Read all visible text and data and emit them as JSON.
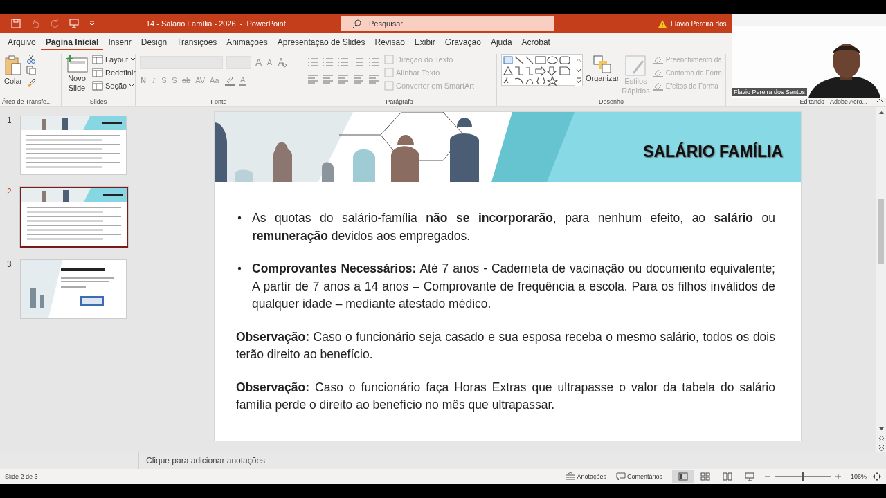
{
  "title_bar": {
    "title": "14 - Salário Família - 2026  -  PowerPoint",
    "search": {
      "placeholder": "Pesquisar"
    },
    "user": "Flavio Pereira dos"
  },
  "tabs": [
    {
      "label": "Arquivo",
      "selected": false
    },
    {
      "label": "Página Inicial",
      "selected": true
    },
    {
      "label": "Inserir",
      "selected": false
    },
    {
      "label": "Design",
      "selected": false
    },
    {
      "label": "Transições",
      "selected": false
    },
    {
      "label": "Animações",
      "selected": false
    },
    {
      "label": "Apresentação de Slides",
      "selected": false
    },
    {
      "label": "Revisão",
      "selected": false
    },
    {
      "label": "Exibir",
      "selected": false
    },
    {
      "label": "Gravação",
      "selected": false
    },
    {
      "label": "Ajuda",
      "selected": false
    },
    {
      "label": "Acrobat",
      "selected": false
    }
  ],
  "ribbon": {
    "clipboard": {
      "label": "Área de Transfe...",
      "paste": "Colar"
    },
    "slides": {
      "label": "Slides",
      "new_slide": [
        "Novo",
        "Slide"
      ],
      "items": [
        {
          "label": "Layout",
          "dropdown": true
        },
        {
          "label": "Redefinir",
          "dropdown": false
        },
        {
          "label": "Seção",
          "dropdown": true
        }
      ]
    },
    "font": {
      "label": "Fonte",
      "grow": "A",
      "shrink": "A",
      "format_buttons": [
        "N",
        "I",
        "S",
        "S",
        "ab",
        "AV",
        "Aa"
      ],
      "color_buttons": [
        "A"
      ]
    },
    "paragraph": {
      "label": "Parágrafo",
      "items": [
        {
          "label": "Direção do Texto",
          "disabled": true
        },
        {
          "label": "Alinhar Texto",
          "disabled": true
        },
        {
          "label": "Converter em SmartArt",
          "disabled": true
        }
      ]
    },
    "drawing": {
      "label": "Desenho",
      "arrange": "Organizar",
      "quick_styles": {
        "label": [
          "Estilos",
          "Rápidos"
        ],
        "disabled": true
      },
      "items": [
        {
          "label": "Preenchimento da",
          "disabled": true
        },
        {
          "label": "Contorno da Form",
          "disabled": true
        },
        {
          "label": "Efeitos de Forma",
          "disabled": true
        }
      ]
    },
    "editing": {
      "label": "Editando"
    },
    "adobe": {
      "label": "Adobe Acro..."
    }
  },
  "webcam": {
    "kind": "picture",
    "name": "Flavio Pereira dos Santos"
  },
  "slides_panel": [
    {
      "number": "1",
      "selected": false
    },
    {
      "number": "2",
      "selected": true
    },
    {
      "number": "3",
      "selected": false
    }
  ],
  "slide": {
    "title": "SALÁRIO FAMÍLIA",
    "paragraphs": [
      {
        "kind": "bullet",
        "text": "As quotas do salário-família **não se incorporarão**, para nenhum efeito, ao **salário** ou **remuneração** devidos aos empregados."
      },
      {
        "kind": "bullet",
        "text": "**Comprovantes Necessários:** Até 7 anos - Caderneta de vacinação ou documento equivalente; A partir de 7 anos a 14 anos – Comprovante de frequência a escola. Para os filhos inválidos de qualquer idade – mediante atestado médico."
      },
      {
        "kind": "plain",
        "text": "**Observação:** Caso o funcionário seja casado e sua esposa receba o mesmo salário, todos os dois terão direito ao benefício."
      },
      {
        "kind": "plain",
        "text": "**Observação:** Caso o funcionário faça Horas Extras que ultrapasse o valor da tabela do salário família perde o direito ao benefício no mês que ultrapassar."
      }
    ]
  },
  "notes": {
    "placeholder": "Clique para adicionar anotações"
  },
  "status_bar": {
    "slide_info": "Slide 2 de 3",
    "notes": "Anotações",
    "comments": "Comentários",
    "views": [
      {
        "kind": "normal",
        "selected": true
      },
      {
        "kind": "sorter",
        "selected": false
      },
      {
        "kind": "reading",
        "selected": false
      },
      {
        "kind": "show",
        "selected": false
      }
    ],
    "zoom": {
      "level": 0.5,
      "value": "106%"
    }
  }
}
